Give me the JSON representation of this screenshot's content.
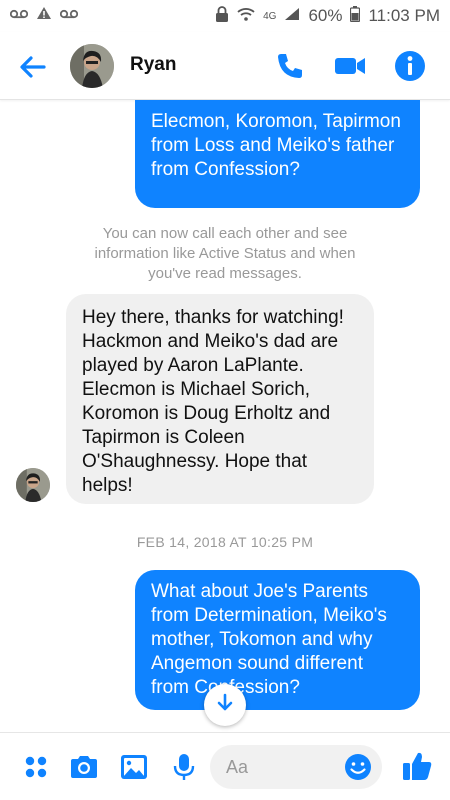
{
  "status_bar": {
    "network": "4G",
    "battery": "60%",
    "time": "11:03 PM"
  },
  "header": {
    "contact_name": "Ryan"
  },
  "messages": {
    "outgoing_1": "Elecmon, Koromon, Tapirmon from Loss and Meiko's father from Confession?",
    "system_notice": "You can now call each other and see information like Active Status and when you've read messages.",
    "incoming_1": "Hey there, thanks for watching! Hackmon and Meiko's dad are played by Aaron LaPlante. Elecmon is Michael Sorich, Koromon is Doug Erholtz and Tapirmon is Coleen O'Shaughnessy.  Hope that helps!",
    "timestamp": "FEB 14, 2018 AT 10:25 PM",
    "outgoing_2": "What about Joe's Parents from Determination, Meiko's mother, Tokomon and why Angemon sound different from Confession?"
  },
  "composer": {
    "placeholder": "Aa"
  },
  "colors": {
    "accent": "#0f83ff",
    "incoming_bubble": "#f0f0f0"
  },
  "icons": [
    "back-arrow-icon",
    "phone-icon",
    "video-camera-icon",
    "info-icon",
    "more-apps-icon",
    "camera-icon",
    "image-icon",
    "microphone-icon",
    "emoji-icon",
    "thumbs-up-icon",
    "arrow-down-icon"
  ]
}
